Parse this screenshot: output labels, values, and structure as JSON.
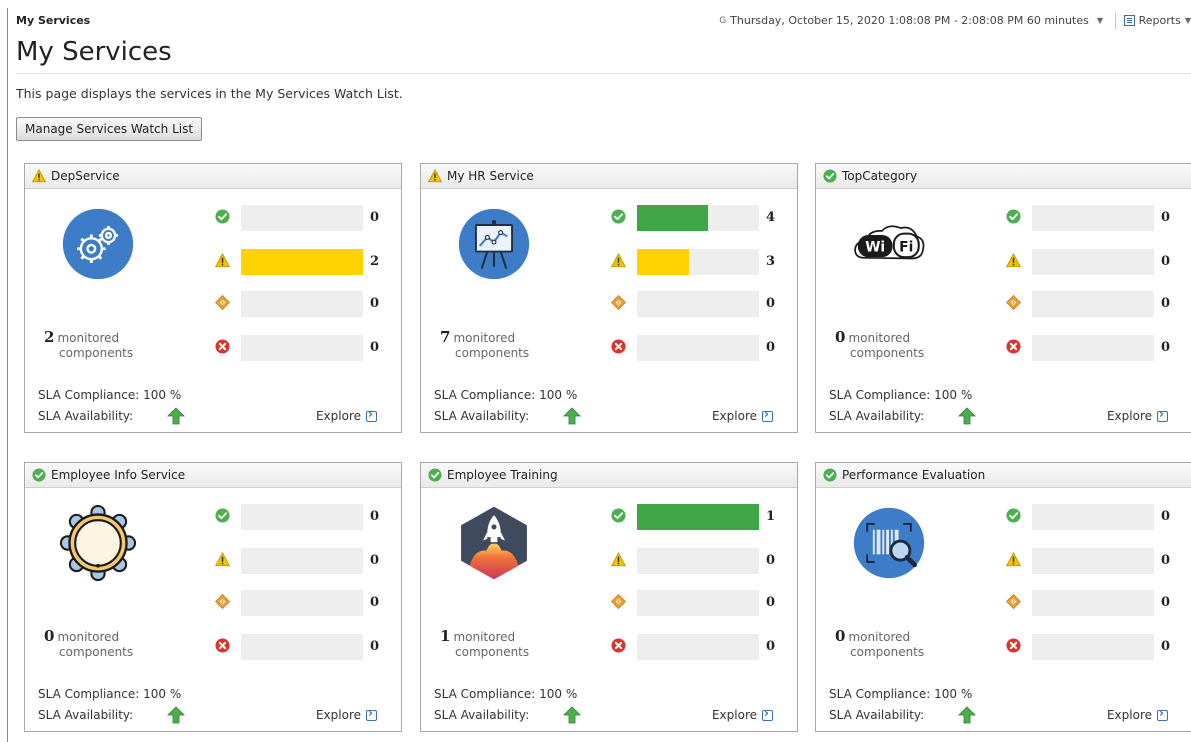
{
  "header": {
    "breadcrumb": "My Services",
    "time_range": "Thursday, October 15, 2020 1:08:08 PM - 2:08:08 PM 60 minutes",
    "reports_label": "Reports"
  },
  "page": {
    "title": "My Services",
    "description": "This page displays the services in the My Services Watch List.",
    "manage_button": "Manage Services Watch List"
  },
  "labels": {
    "monitored_1": "monitored",
    "monitored_2": "components",
    "sla_compliance": "SLA Compliance: 100 %",
    "sla_availability": "SLA Availability:",
    "explore": "Explore"
  },
  "colors": {
    "normal": "#4caf50",
    "warning": "#f2c400",
    "critical": "#e8a033",
    "fatal": "#d9342b",
    "bar_green": "#3fa648",
    "bar_yellow": "#ffd200",
    "track": "#eeeeee"
  },
  "services": [
    {
      "name": "DepService",
      "state": "warning",
      "icon": "gears-icon",
      "monitored": "2",
      "counts": {
        "normal": "0",
        "warning": "2",
        "critical": "0",
        "fatal": "0"
      },
      "fill": {
        "normal": 0,
        "warning": 1,
        "critical": 0,
        "fatal": 0
      }
    },
    {
      "name": "My HR Service",
      "state": "warning",
      "icon": "presentation-chart-icon",
      "monitored": "7",
      "counts": {
        "normal": "4",
        "warning": "3",
        "critical": "0",
        "fatal": "0"
      },
      "fill": {
        "normal": 0.58,
        "warning": 0.43,
        "critical": 0,
        "fatal": 0
      }
    },
    {
      "name": "TopCategory",
      "state": "normal",
      "icon": "wifi-cloud-icon",
      "monitored": "0",
      "counts": {
        "normal": "0",
        "warning": "0",
        "critical": "0",
        "fatal": "0"
      },
      "fill": {
        "normal": 0,
        "warning": 0,
        "critical": 0,
        "fatal": 0
      }
    },
    {
      "name": "Employee Info Service",
      "state": "normal",
      "icon": "flower-ring-icon",
      "monitored": "0",
      "counts": {
        "normal": "0",
        "warning": "0",
        "critical": "0",
        "fatal": "0"
      },
      "fill": {
        "normal": 0,
        "warning": 0,
        "critical": 0,
        "fatal": 0
      }
    },
    {
      "name": "Employee Training",
      "state": "normal",
      "icon": "rocket-icon",
      "monitored": "1",
      "counts": {
        "normal": "1",
        "warning": "0",
        "critical": "0",
        "fatal": "0"
      },
      "fill": {
        "normal": 1,
        "warning": 0,
        "critical": 0,
        "fatal": 0
      }
    },
    {
      "name": "Performance Evaluation",
      "state": "normal",
      "icon": "barcode-scan-icon",
      "monitored": "0",
      "counts": {
        "normal": "0",
        "warning": "0",
        "critical": "0",
        "fatal": "0"
      },
      "fill": {
        "normal": 0,
        "warning": 0,
        "critical": 0,
        "fatal": 0
      }
    }
  ]
}
